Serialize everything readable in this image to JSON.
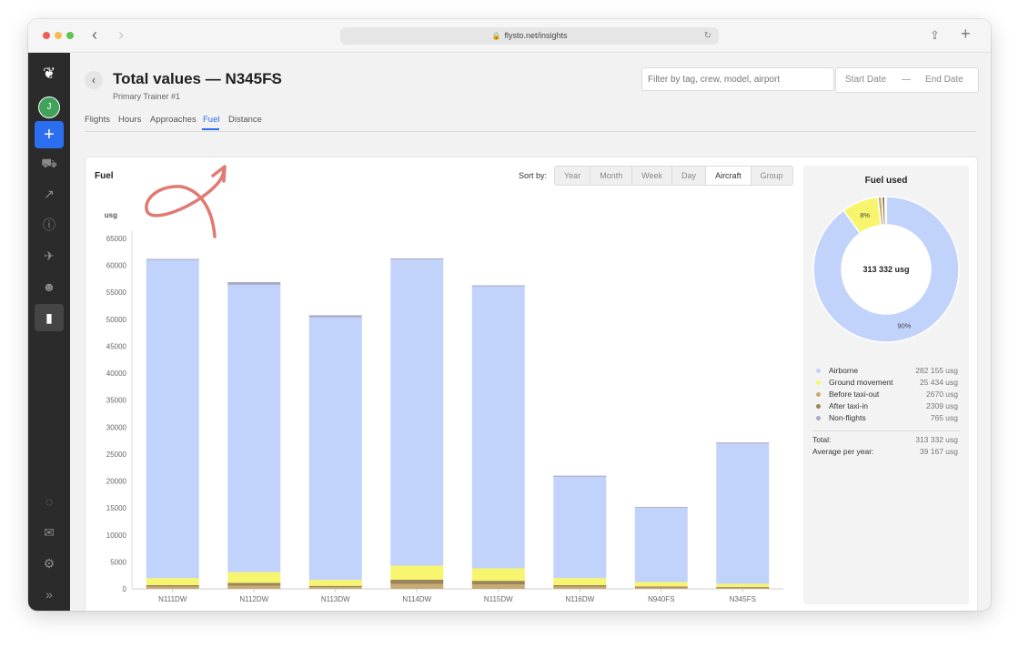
{
  "browser": {
    "url": "flysto.net/insights"
  },
  "sidebar": {
    "avatar_initial": "J",
    "logo_icon": "feather-logo-icon",
    "icons": [
      "plus-icon",
      "landing-icon",
      "departure-icon",
      "alert-icon",
      "plane-icon",
      "crew-icon",
      "bar-chart-icon",
      "bulb-icon",
      "mail-icon",
      "gear-icon",
      "expand-icon"
    ]
  },
  "header": {
    "title": "Total values —  N345FS",
    "subtitle": "Primary Trainer #1",
    "filter_placeholder": "Filter by tag, crew, model, airport",
    "start_date": "Start Date",
    "date_separator": "—",
    "end_date": "End Date"
  },
  "tabs": [
    "Flights",
    "Hours",
    "Approaches",
    "Fuel",
    "Distance"
  ],
  "active_tab": "Fuel",
  "panel": {
    "title": "Fuel",
    "sort_label": "Sort by:",
    "sort_options": [
      "Year",
      "Month",
      "Week",
      "Day",
      "Aircraft",
      "Group"
    ],
    "sort_active": "Aircraft"
  },
  "colors": {
    "airborne": "#c2d3fb",
    "ground_movement": "#f7f56e",
    "before_taxi_out": "#c8ab73",
    "after_taxi_in": "#9a845a",
    "non_flights": "#a9a9c6",
    "accent": "#2b6ff0"
  },
  "chart_data": [
    {
      "type": "bar",
      "stacked": true,
      "ylabel": "usg",
      "ylim": [
        0,
        65000
      ],
      "yticks": [
        0,
        5000,
        10000,
        15000,
        20000,
        25000,
        30000,
        35000,
        40000,
        45000,
        50000,
        55000,
        60000,
        65000
      ],
      "categories": [
        "N111DW",
        "N112DW",
        "N113DW",
        "N114DW",
        "N115DW",
        "N116DW",
        "N940FS",
        "N345FS"
      ],
      "series": [
        {
          "name": "Before taxi-out",
          "values": [
            400,
            600,
            300,
            900,
            800,
            400,
            250,
            200
          ]
        },
        {
          "name": "After taxi-in",
          "values": [
            300,
            500,
            250,
            800,
            700,
            300,
            200,
            150
          ]
        },
        {
          "name": "Ground movement",
          "values": [
            1300,
            2000,
            1100,
            2600,
            2300,
            1300,
            800,
            600
          ]
        },
        {
          "name": "Airborne",
          "values": [
            59000,
            53300,
            48700,
            56800,
            52300,
            18800,
            13800,
            26000
          ]
        },
        {
          "name": "Non-flights",
          "values": [
            200,
            500,
            400,
            200,
            200,
            200,
            150,
            200
          ]
        }
      ]
    },
    {
      "type": "pie",
      "donut": true,
      "title": "Fuel used",
      "center_label": "313 332 usg",
      "labels": [
        "Airborne",
        "Ground movement",
        "Before taxi-out",
        "After taxi-in",
        "Non-flights"
      ],
      "values": [
        282155,
        25434,
        2670,
        2309,
        765
      ],
      "value_labels": [
        "282 155 usg",
        "25 434 usg",
        "2670 usg",
        "2309 usg",
        "765 usg"
      ],
      "slice_labels": [
        "90%",
        "8%"
      ]
    }
  ],
  "totals": {
    "total_label": "Total:",
    "total_value": "313 332 usg",
    "avg_label": "Average per year:",
    "avg_value": "39 167 usg"
  }
}
